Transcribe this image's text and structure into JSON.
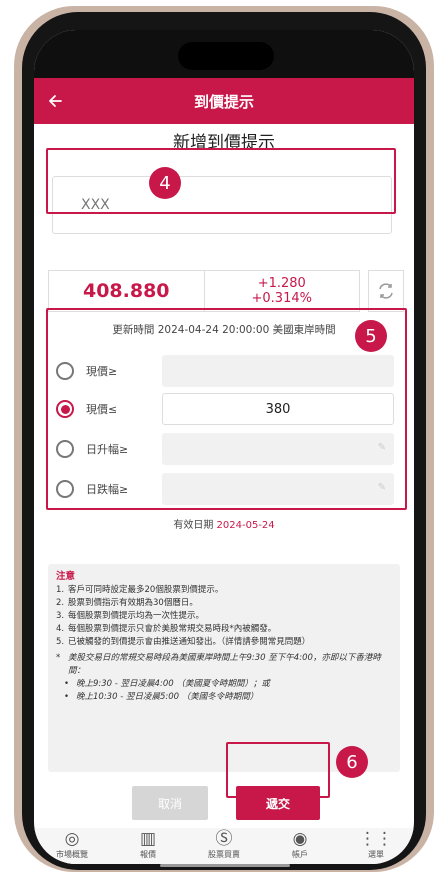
{
  "header": {
    "title": "到價提示",
    "back_icon": "arrow-left-icon"
  },
  "form": {
    "subtitle": "新增到價提示"
  },
  "search": {
    "value": "XXX"
  },
  "quote": {
    "price": "408.880",
    "change": "+1.280",
    "change_pct": "+0.314%",
    "refresh_icon": "refresh-icon",
    "update_time": "更新時間 2024-04-24 20:00:00 美國東岸時間"
  },
  "conditions": [
    {
      "label": "現價≥",
      "value": "",
      "selected": false
    },
    {
      "label": "現價≤",
      "value": "380",
      "selected": true
    },
    {
      "label": "日升幅≥",
      "value": "",
      "selected": false
    },
    {
      "label": "日跌幅≥",
      "value": "",
      "selected": false
    }
  ],
  "expiry": {
    "label": "有效日期",
    "date": "2024-05-24"
  },
  "notes": {
    "title": "注意",
    "items": [
      "客戶可同時設定最多20個股票到價提示。",
      "股票到價指示有效期為30個曆日。",
      "每個股票到價提示均為一次性提示。",
      "每個股票到價提示只會於美股常規交易時段*內被觸發。",
      "已被觸發的到價提示會由推送通知發出。（詳情請參閱常見問題）"
    ],
    "star_note": "美股交易日的常規交易時段為美國東岸時間上午9:30 至下午4:00，亦即以下香港時間：",
    "bullets": [
      "晚上9:30 - 翌日凌晨4:00 （美國夏令時期間）；或",
      "晚上10:30 - 翌日凌晨5:00 （美國冬令時期間）"
    ]
  },
  "buttons": {
    "cancel": "取消",
    "submit": "遞交"
  },
  "callouts": {
    "search": "4",
    "conditions": "5",
    "submit": "6"
  },
  "nav": [
    {
      "label": "市場概覽",
      "icon": "globe-icon"
    },
    {
      "label": "報價",
      "icon": "chart-icon"
    },
    {
      "label": "股票買賣",
      "icon": "dollar-icon"
    },
    {
      "label": "帳戶",
      "icon": "account-icon"
    },
    {
      "label": "選單",
      "icon": "menu-grid-icon"
    }
  ],
  "colors": {
    "brand": "#c8184a",
    "callout": "#c8184a"
  }
}
